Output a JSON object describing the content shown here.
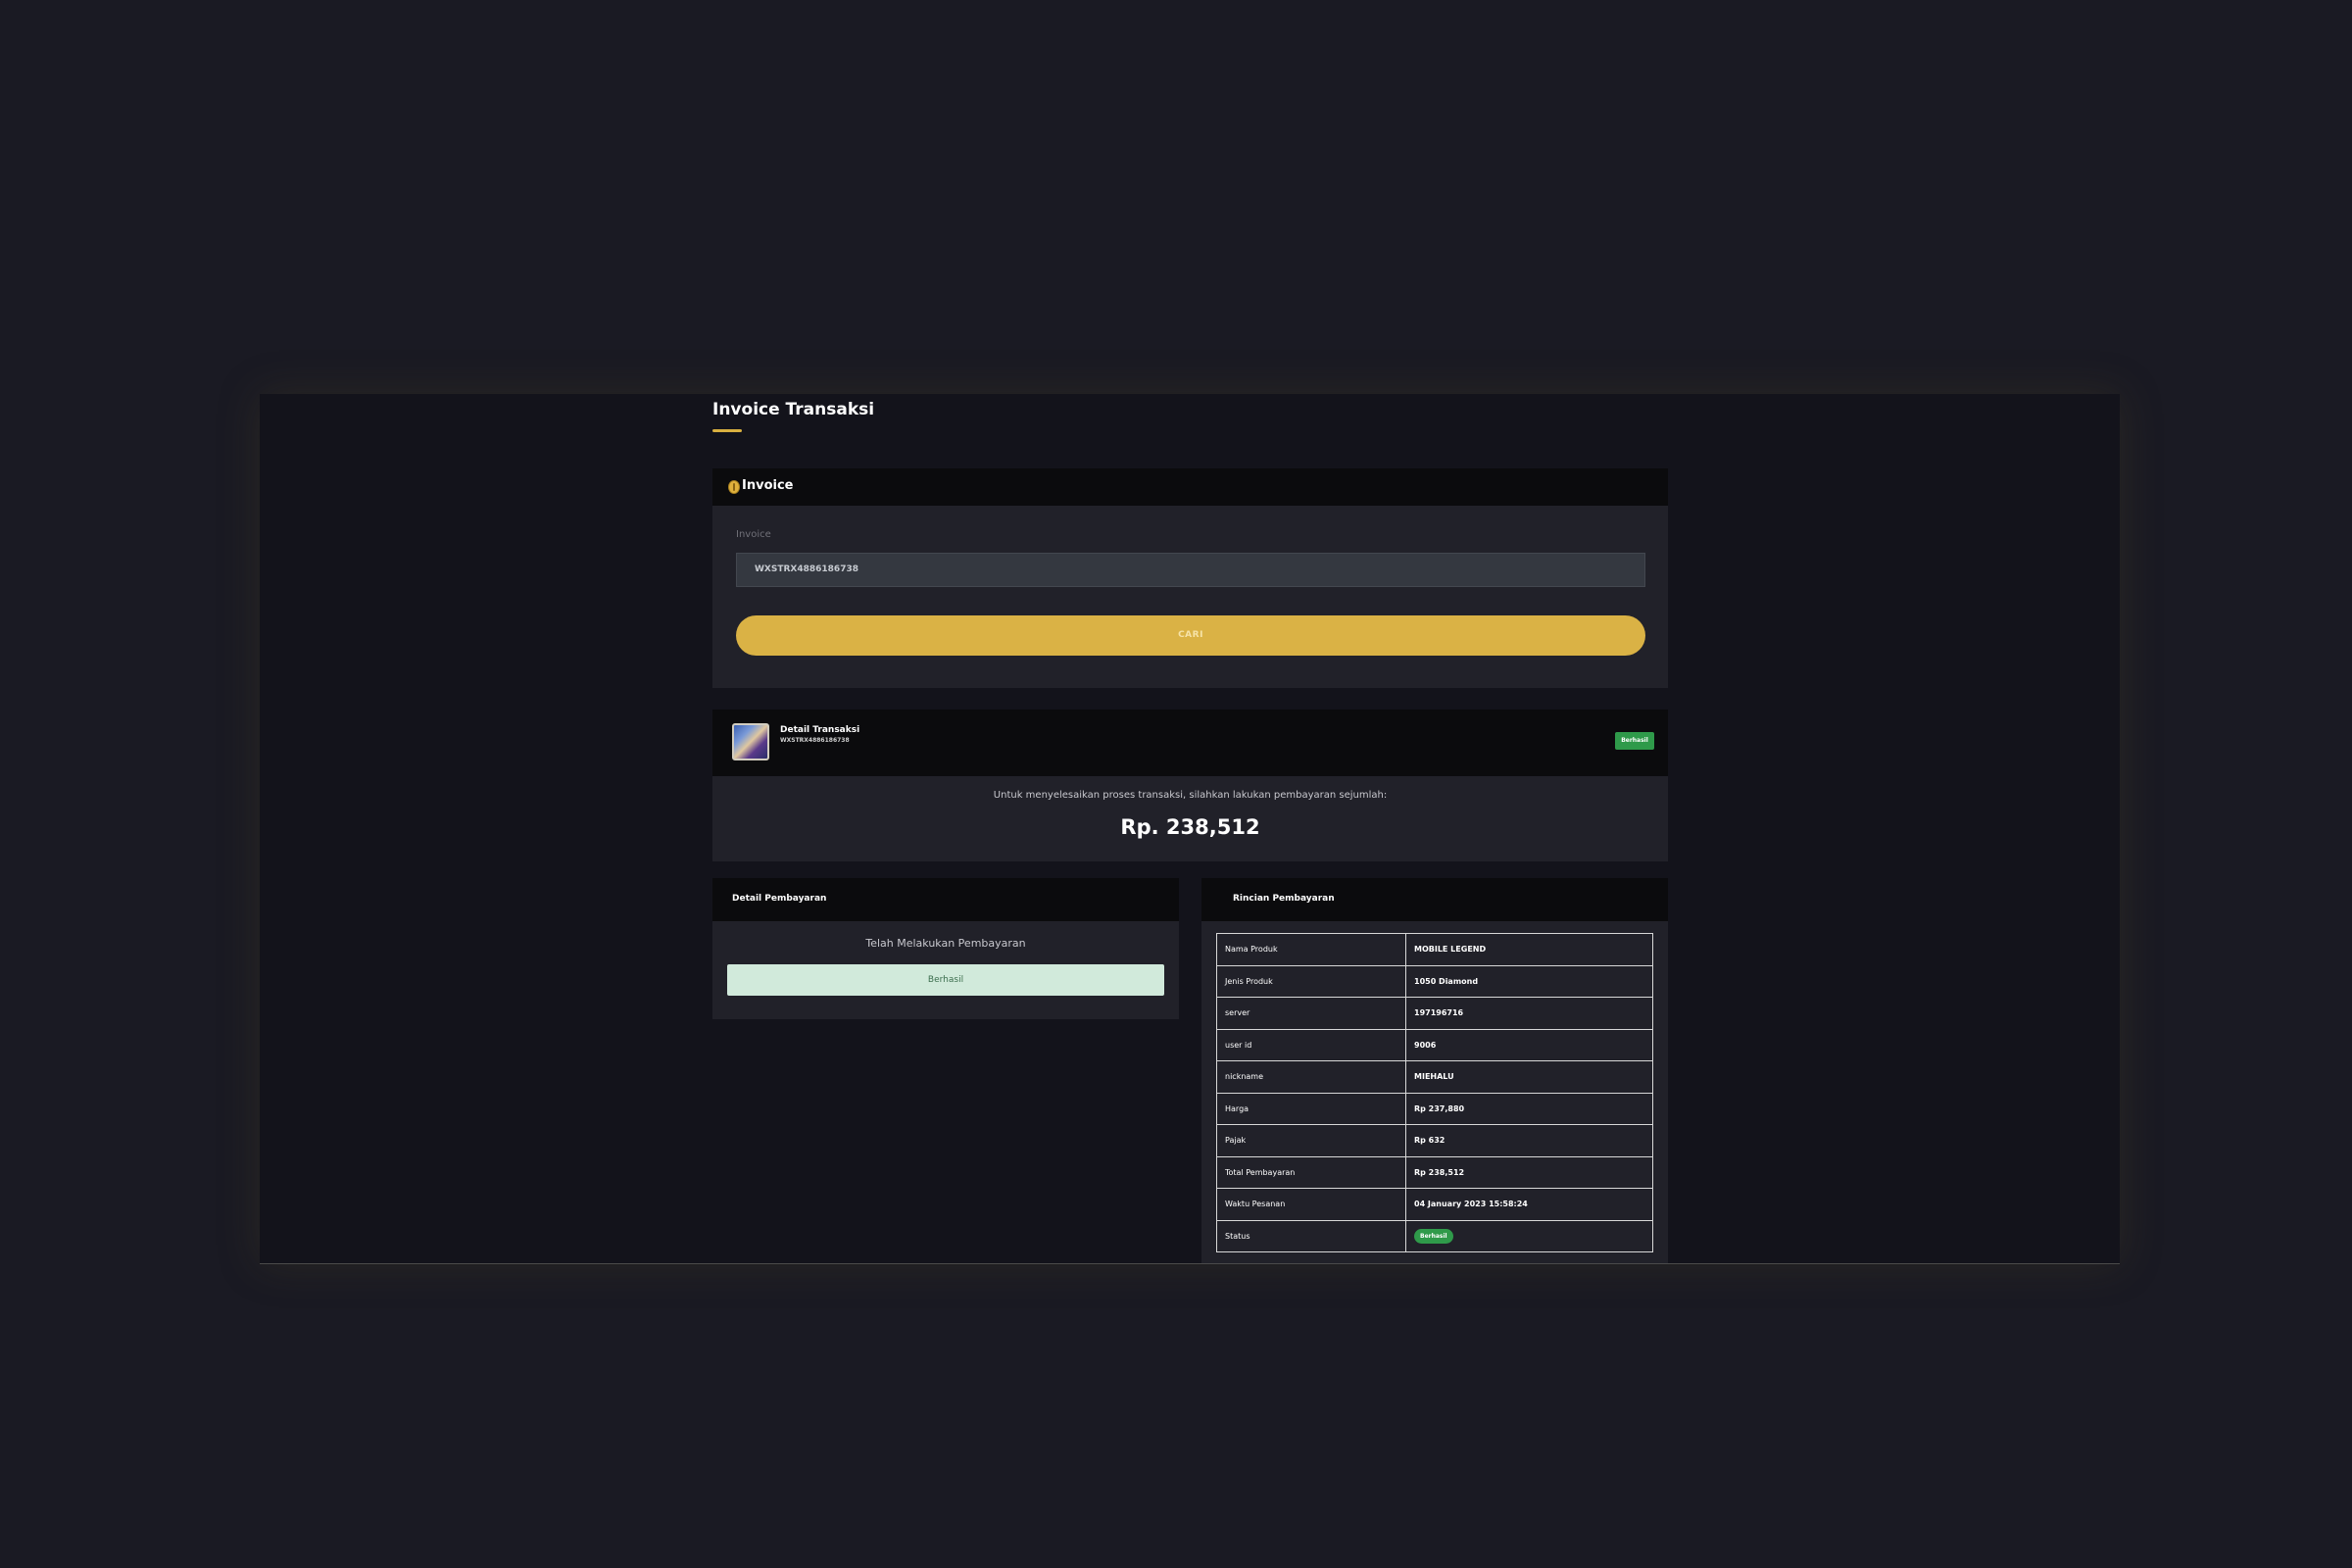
{
  "page": {
    "title": "Invoice Transaksi"
  },
  "invoice_card": {
    "title": "Invoice",
    "field_label": "Invoice",
    "field_value": "WXSTRX4886186738",
    "search_button": "CARI"
  },
  "detail_transaksi": {
    "title": "Detail Transaksi",
    "invoice_id": "WXSTRX4886186738",
    "status_badge": "Berhasil",
    "note": "Untuk menyelesaikan proses transaksi, silahkan lakukan pembayaran sejumlah:",
    "amount": "Rp. 238,512"
  },
  "detail_pembayaran": {
    "title": "Detail Pembayaran",
    "message": "Telah Melakukan Pembayaran",
    "status": "Berhasil"
  },
  "rincian_pembayaran": {
    "title": "Rincian Pembayaran",
    "rows": [
      {
        "label": "Nama Produk",
        "value": "MOBILE LEGEND"
      },
      {
        "label": "Jenis Produk",
        "value": "1050 Diamond"
      },
      {
        "label": "server",
        "value": "197196716"
      },
      {
        "label": "user id",
        "value": "9006"
      },
      {
        "label": "nickname",
        "value": "MIEHALU"
      },
      {
        "label": "Harga",
        "value": "Rp 237,880"
      },
      {
        "label": "Pajak",
        "value": "Rp 632"
      },
      {
        "label": "Total Pembayaran",
        "value": "Rp 238,512"
      },
      {
        "label": "Waktu Pesanan",
        "value": "04 January 2023 15:58:24"
      },
      {
        "label": "Status",
        "value": "Berhasil"
      }
    ]
  },
  "colors": {
    "accent": "#dab245",
    "success": "#2f9a4a",
    "background": "#1a1a23",
    "card": "#212129",
    "card_header": "#0b0b0d"
  }
}
